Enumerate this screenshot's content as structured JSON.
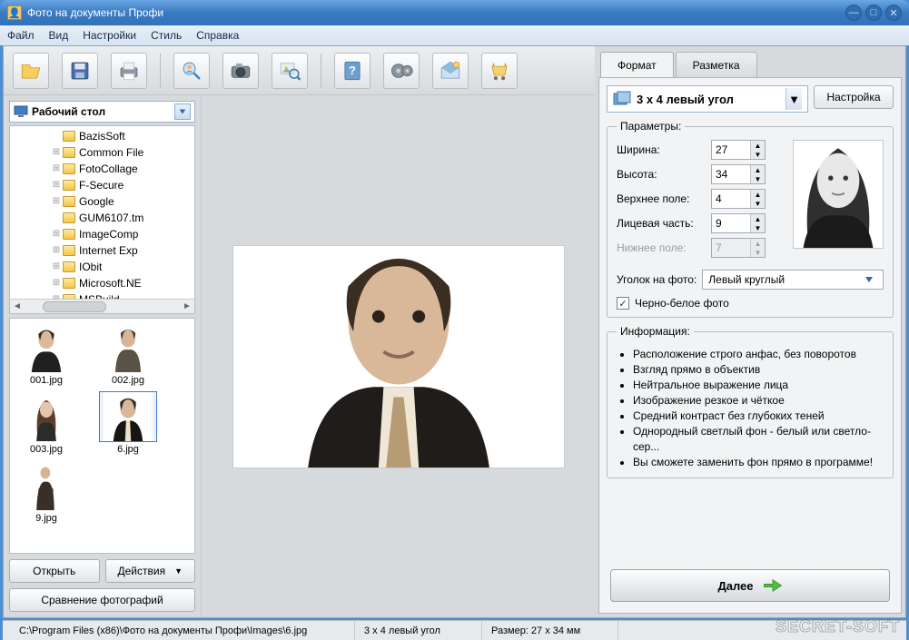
{
  "window": {
    "title": "Фото на документы Профи"
  },
  "menu": {
    "file": "Файл",
    "view": "Вид",
    "settings": "Настройки",
    "style": "Стиль",
    "help": "Справка"
  },
  "toolbar_icons": [
    "open",
    "save",
    "print",
    "zoom-user",
    "camera",
    "find-photo",
    "help",
    "video",
    "wizard",
    "cart"
  ],
  "left": {
    "location": "Рабочий стол",
    "tree": [
      {
        "glyph": "",
        "name": "BazisSoft"
      },
      {
        "glyph": "+",
        "name": "Common File"
      },
      {
        "glyph": "+",
        "name": "FotoCollage"
      },
      {
        "glyph": "+",
        "name": "F-Secure"
      },
      {
        "glyph": "+",
        "name": "Google"
      },
      {
        "glyph": "",
        "name": "GUM6107.tm"
      },
      {
        "glyph": "+",
        "name": "ImageComp"
      },
      {
        "glyph": "+",
        "name": "Internet Exp"
      },
      {
        "glyph": "+",
        "name": "IObit"
      },
      {
        "glyph": "+",
        "name": "Microsoft.NE"
      },
      {
        "glyph": "+",
        "name": "MSBuild"
      }
    ],
    "thumbs": [
      {
        "name": "001.jpg",
        "sel": false,
        "kind": "m1"
      },
      {
        "name": "002.jpg",
        "sel": false,
        "kind": "m2"
      },
      {
        "name": "003.jpg",
        "sel": false,
        "kind": "w1"
      },
      {
        "name": "6.jpg",
        "sel": true,
        "kind": "m3"
      },
      {
        "name": "9.jpg",
        "sel": false,
        "kind": "m4"
      }
    ],
    "open": "Открыть",
    "actions": "Действия",
    "compare": "Сравнение фотографий"
  },
  "tabs": {
    "format": "Формат",
    "layout": "Разметка"
  },
  "format": {
    "preset": "3 x 4 левый угол",
    "config_btn": "Настройка",
    "params_legend": "Параметры:",
    "width_label": "Ширина:",
    "width": "27",
    "height_label": "Высота:",
    "height": "34",
    "top_label": "Верхнее поле:",
    "top": "4",
    "face_label": "Лицевая часть:",
    "face": "9",
    "bottom_label": "Нижнее поле:",
    "bottom": "7",
    "corner_label": "Уголок на фото:",
    "corner_value": "Левый круглый",
    "bw_label": "Черно-белое фото",
    "info_legend": "Информация:",
    "info": [
      "Расположение строго анфас, без поворотов",
      "Взгляд прямо в объектив",
      "Нейтральное выражение лица",
      "Изображение резкое и чёткое",
      "Средний контраст без глубоких теней",
      "Однородный светлый фон - белый или светло-сер...",
      "Вы сможете заменить фон прямо в программе!"
    ],
    "next": "Далее"
  },
  "status": {
    "path": "C:\\Program Files (x86)\\Фото на документы Профи\\Images\\6.jpg",
    "preset": "3 x 4 левый угол",
    "size": "Размер: 27 x 34 мм"
  },
  "watermark": "SECRET-SOFT"
}
